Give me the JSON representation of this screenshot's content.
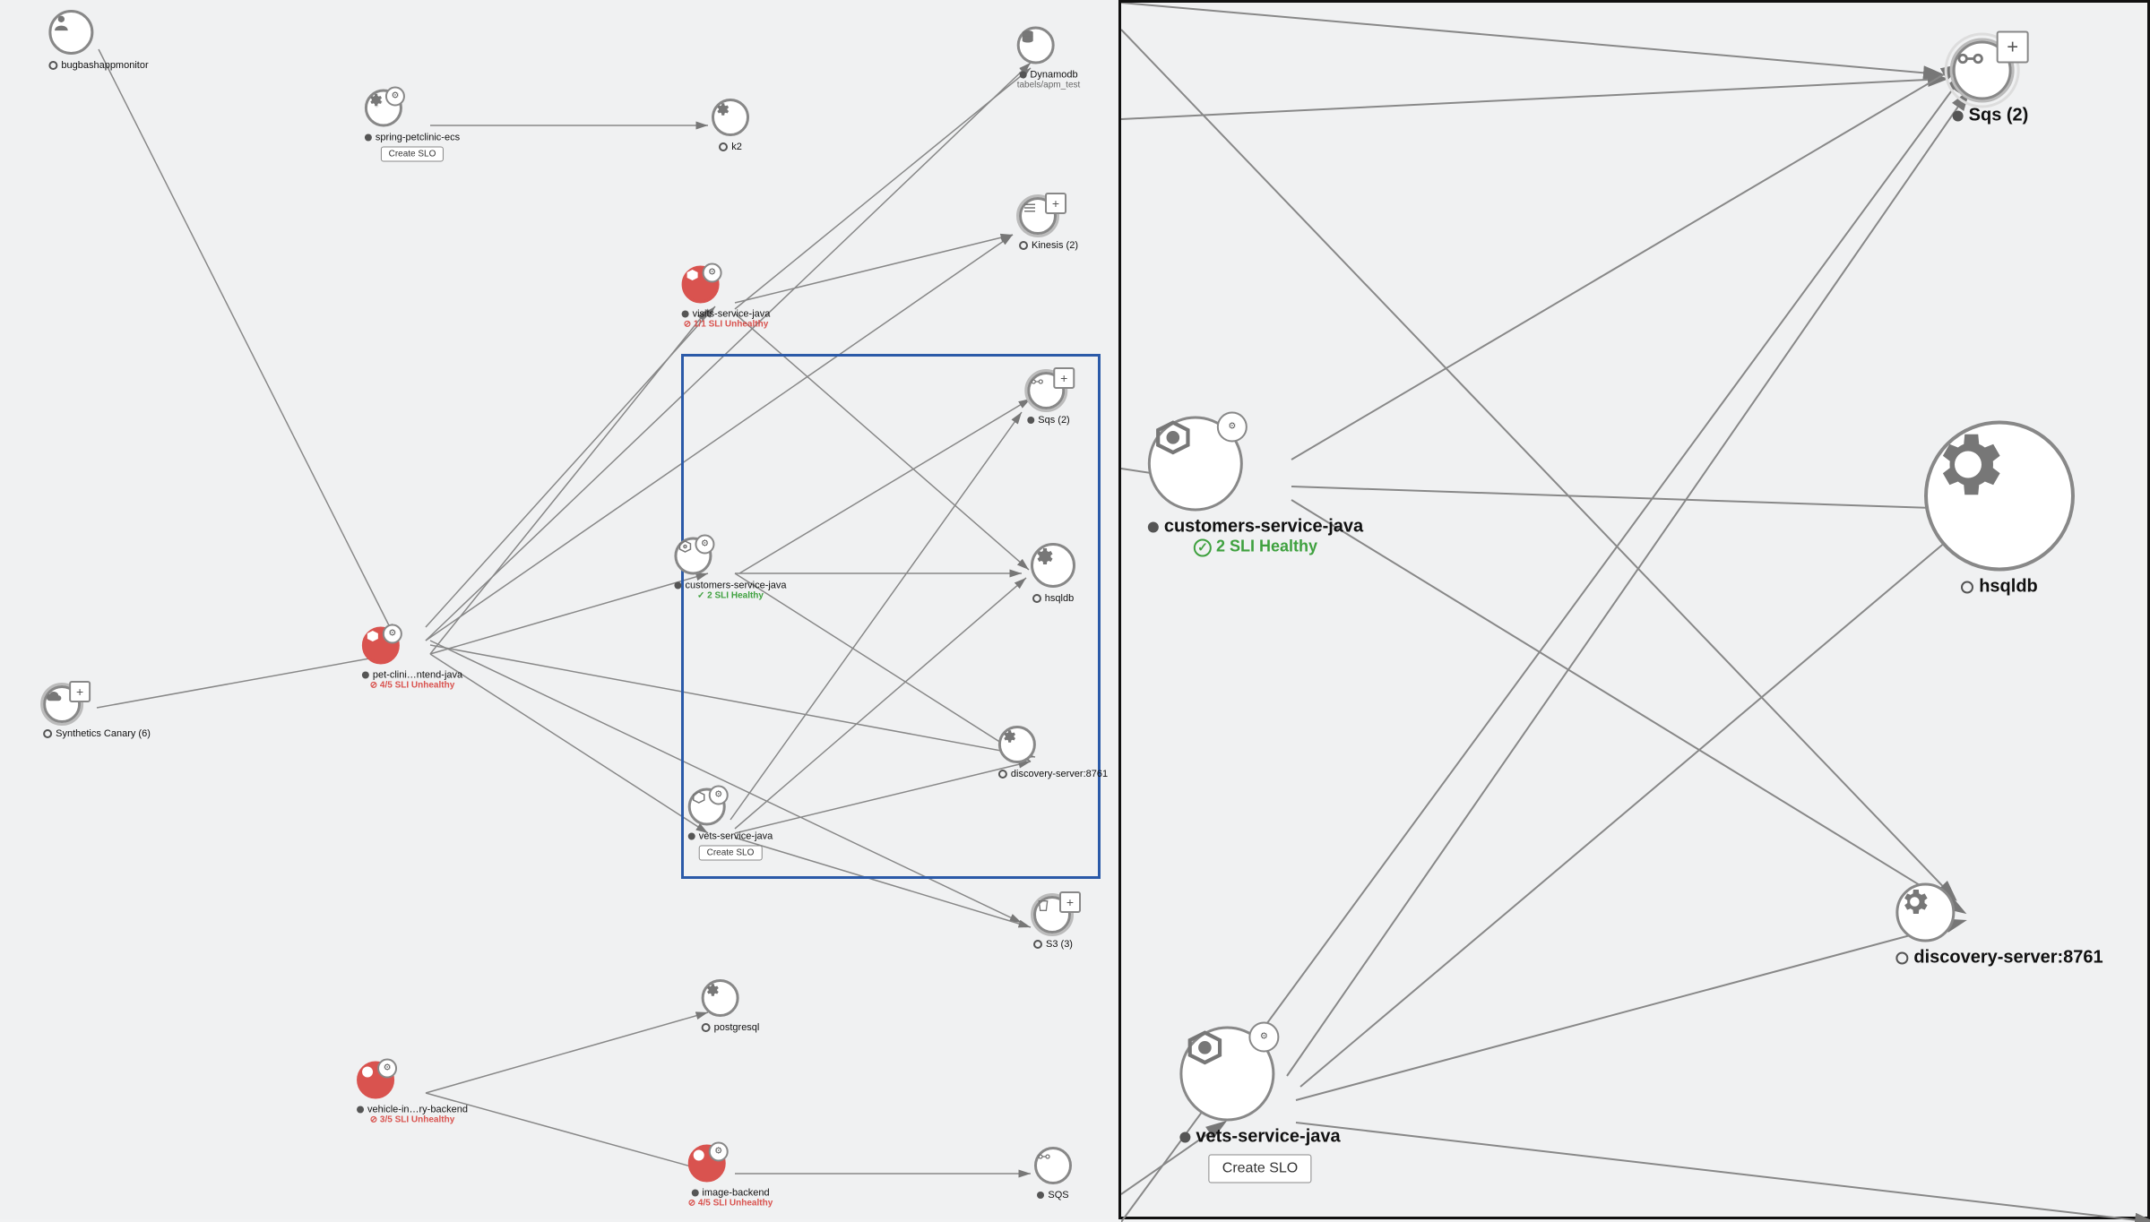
{
  "left": {
    "nodes": {
      "user": {
        "label": "bugbashappmonitor"
      },
      "spring": {
        "label": "spring-petclinic-ecs",
        "button": "Create SLO"
      },
      "k2": {
        "label": "k2"
      },
      "dynamo": {
        "label": "Dynamodb",
        "sub": "tabels/apm_test"
      },
      "kinesis": {
        "label": "Kinesis (2)"
      },
      "visits": {
        "label": "visits-service-java",
        "status": "1/1 SLI Unhealthy"
      },
      "sqs": {
        "label": "Sqs (2)"
      },
      "customers": {
        "label": "customers-service-java",
        "status": "2 SLI Healthy"
      },
      "hsqldb": {
        "label": "hsqldb"
      },
      "frontend": {
        "label": "pet-clini…ntend-java",
        "status": "4/5 SLI Unhealthy"
      },
      "canary": {
        "label": "Synthetics Canary (6)"
      },
      "discovery": {
        "label": "discovery-server:8761"
      },
      "vets": {
        "label": "vets-service-java",
        "button": "Create SLO"
      },
      "s3": {
        "label": "S3 (3)"
      },
      "postgres": {
        "label": "postgresql"
      },
      "vehicle": {
        "label": "vehicle-in…ry-backend",
        "status": "3/5 SLI Unhealthy"
      },
      "image": {
        "label": "image-backend",
        "status": "4/5 SLI Unhealthy"
      },
      "sqs2": {
        "label": "SQS"
      }
    }
  },
  "right": {
    "nodes": {
      "sqs": {
        "label": "Sqs (2)"
      },
      "customers": {
        "label": "customers-service-java",
        "status": "2 SLI Healthy"
      },
      "hsqldb": {
        "label": "hsqldb"
      },
      "discovery": {
        "label": "discovery-server:8761"
      },
      "vets": {
        "label": "vets-service-java",
        "button": "Create SLO"
      }
    }
  },
  "icons": {
    "check": "✓",
    "plus": "+"
  }
}
